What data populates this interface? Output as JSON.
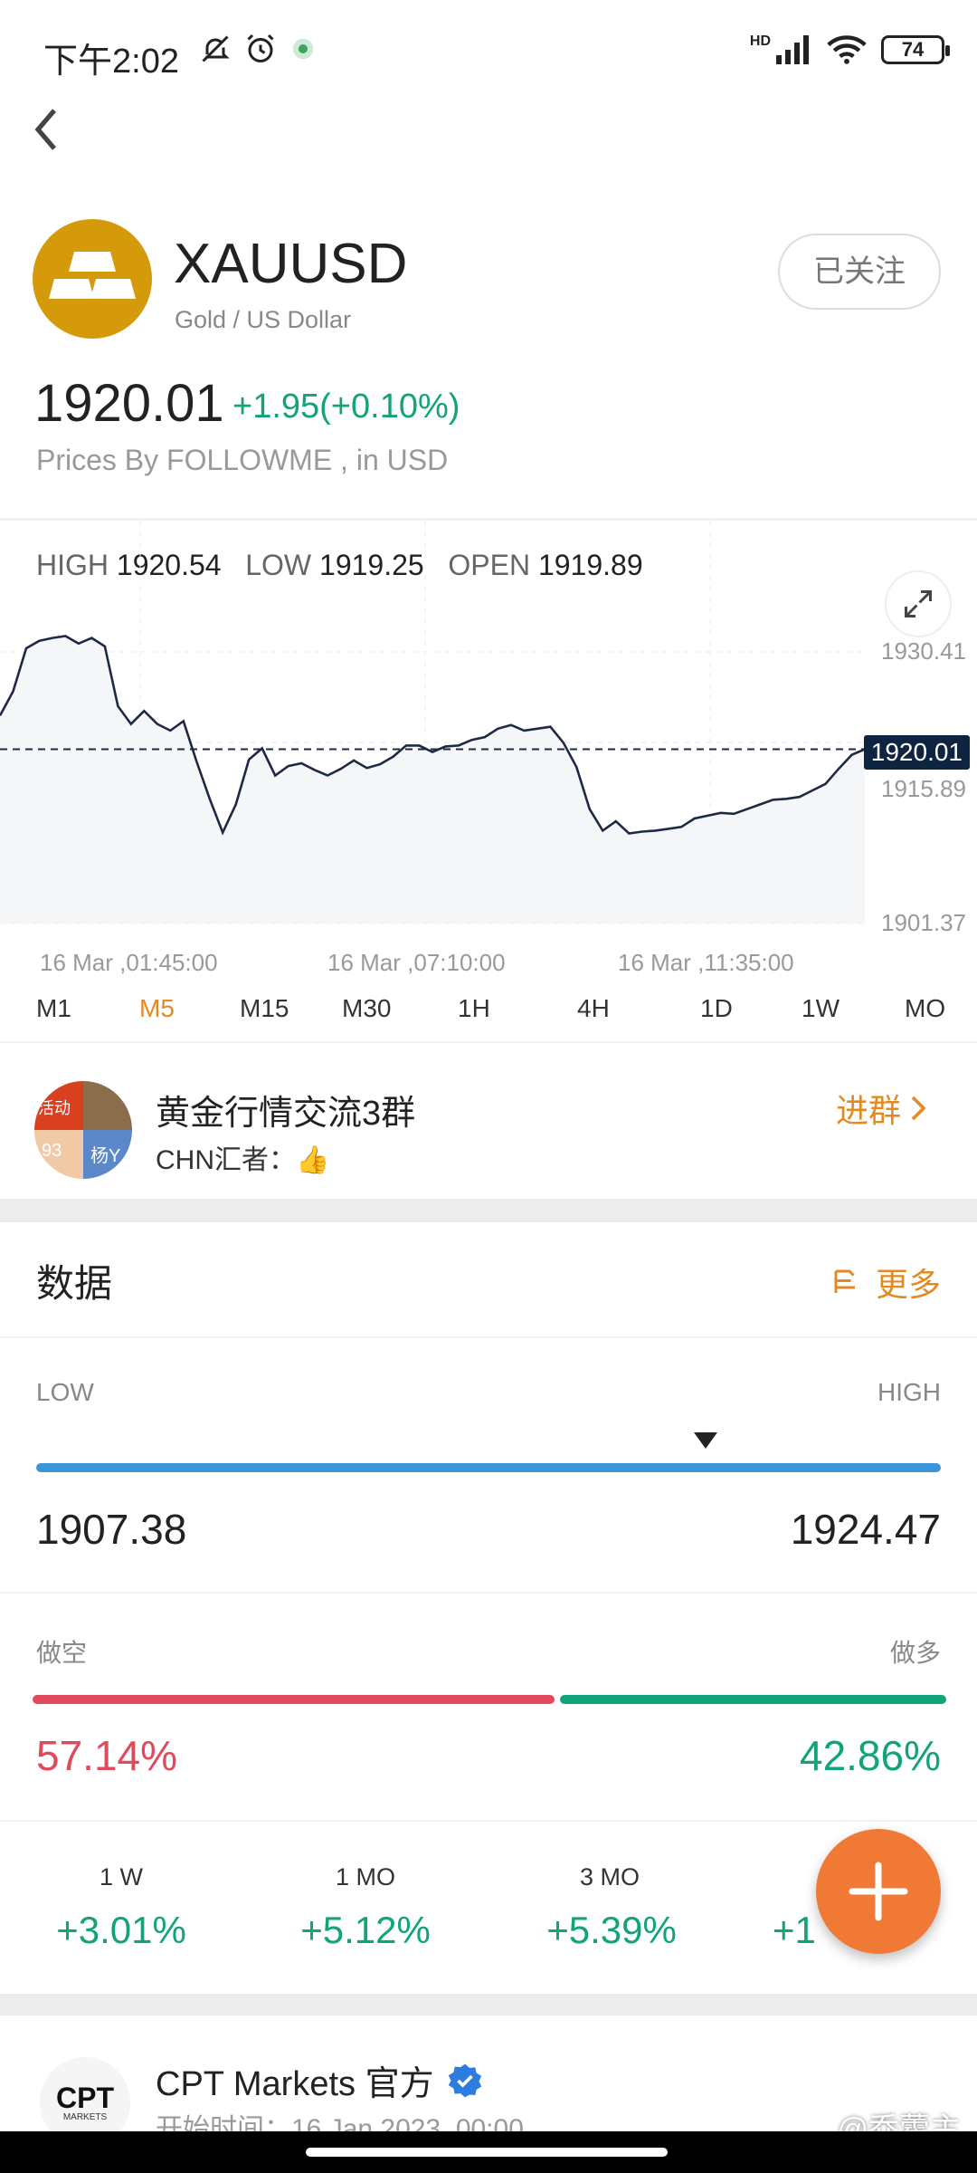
{
  "status": {
    "time": "下午2:02",
    "signal": "HD",
    "battery": "74"
  },
  "header": {
    "symbol": "XAUUSD",
    "subtitle": "Gold / US Dollar",
    "follow_label": "已关注"
  },
  "quote": {
    "price": "1920.01",
    "change": "+1.95(+0.10%)",
    "source": "Prices By FOLLOWME , in USD"
  },
  "chart_stats": {
    "high_label": "HIGH",
    "high": "1920.54",
    "low_label": "LOW",
    "low": "1919.25",
    "open_label": "OPEN",
    "open": "1919.89"
  },
  "chart_data": {
    "type": "line",
    "y_ticks": [
      "1930.41",
      "1915.89",
      "1901.37"
    ],
    "x_ticks": [
      "16 Mar ,01:45:00",
      "16 Mar ,07:10:00",
      "16 Mar ,11:35:00"
    ],
    "current_price_label": "1920.01",
    "ylim": [
      1901.37,
      1930.41
    ],
    "series": [
      {
        "values": [
          1923.6,
          1926.2,
          1930.8,
          1931.6,
          1931.9,
          1932.1,
          1931.3,
          1931.9,
          1931.0,
          1924.6,
          1922.7,
          1924.1,
          1922.7,
          1922.0,
          1923.0,
          1918.7,
          1914.7,
          1911.1,
          1914.1,
          1918.9,
          1920.1,
          1917.2,
          1918.2,
          1918.5,
          1917.8,
          1917.2,
          1917.9,
          1918.8,
          1918.0,
          1918.4,
          1919.2,
          1920.4,
          1920.4,
          1919.7,
          1920.3,
          1920.4,
          1921.0,
          1921.3,
          1922.2,
          1922.6,
          1922.0,
          1922.2,
          1922.4,
          1920.7,
          1918.1,
          1913.6,
          1911.3,
          1912.3,
          1911.0,
          1911.2,
          1911.3,
          1911.5,
          1911.7,
          1912.6,
          1912.9,
          1913.2,
          1913.1,
          1913.6,
          1914.1,
          1914.6,
          1914.7,
          1914.9,
          1915.6,
          1916.3,
          1917.9,
          1919.4,
          1920.0
        ]
      }
    ]
  },
  "timeframes": [
    "M1",
    "M5",
    "M15",
    "M30",
    "1H",
    "4H",
    "1D",
    "1W",
    "MO"
  ],
  "active_timeframe": "M5",
  "group": {
    "name": "黄金行情交流3群",
    "last_message": "CHN汇者：",
    "emoji": "👍",
    "join_label": "进群",
    "avatar_tiles": [
      "活动",
      "93",
      "杨Y"
    ]
  },
  "data_section": {
    "title": "数据",
    "more_label": "更多",
    "low_label": "LOW",
    "high_label": "HIGH",
    "range_low": "1907.38",
    "range_high": "1924.47",
    "range_marker_fraction": 0.74,
    "short_label": "做空",
    "long_label": "做多",
    "short_pct": "57.14%",
    "long_pct": "42.86%",
    "short_fraction": 0.5714
  },
  "performance": [
    {
      "period": "1 W",
      "value": "+3.01%"
    },
    {
      "period": "1 MO",
      "value": "+5.12%"
    },
    {
      "period": "3 MO",
      "value": "+5.39%"
    },
    {
      "period": "",
      "value": "+1"
    }
  ],
  "fab": {
    "icon": "plus-icon"
  },
  "broker": {
    "name": "CPT Markets 官方",
    "logo_text": "CPT",
    "logo_sub": "MARKETS",
    "start_time": "开始时间：16 Jan 2023, 00:00"
  },
  "watermark": "@乔藿主",
  "colors": {
    "accent": "#e38a24",
    "up": "#12a37a",
    "down": "#e04a5c",
    "range": "#3995d8",
    "fab": "#f07a35"
  }
}
